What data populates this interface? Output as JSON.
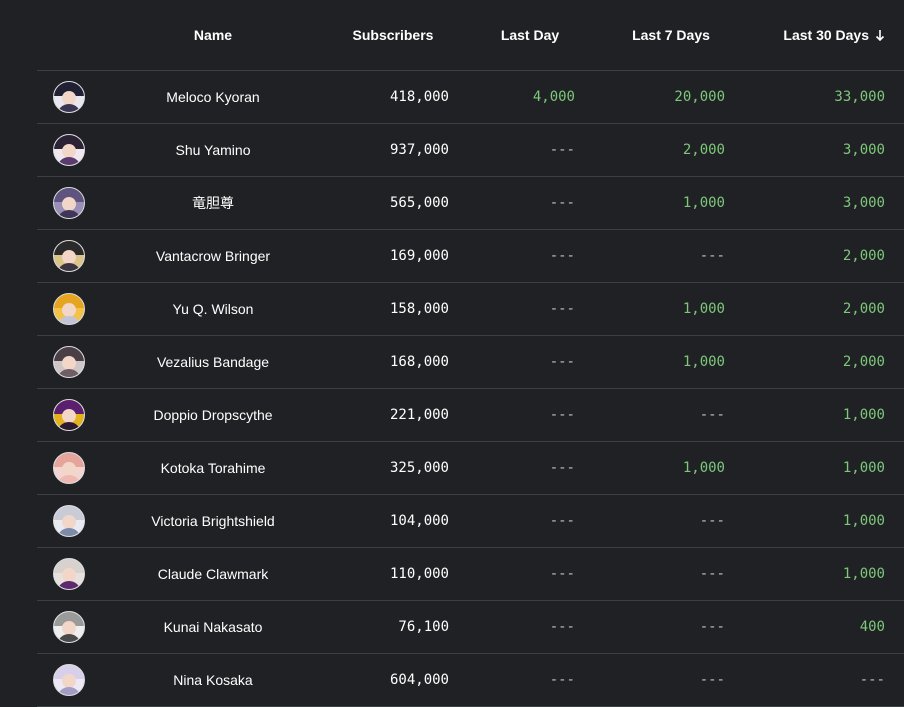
{
  "columns": {
    "name": "Name",
    "subscribers": "Subscribers",
    "last_day": "Last Day",
    "last_7": "Last 7 Days",
    "last_30": "Last 30 Days"
  },
  "sort_icon": "arrow-down-icon",
  "rows": [
    {
      "name": "Meloco Kyoran",
      "subs": "418,000",
      "day": "4,000",
      "week": "20,000",
      "month": "33,000",
      "avatar": {
        "bg": "#e8e6ee",
        "hair": "#1f2033",
        "body": "#3a3550"
      }
    },
    {
      "name": "Shu Yamino",
      "subs": "937,000",
      "day": "---",
      "week": "2,000",
      "month": "3,000",
      "avatar": {
        "bg": "#efe9ef",
        "hair": "#2b2236",
        "body": "#5b3a6e"
      }
    },
    {
      "name": "竜胆尊",
      "subs": "565,000",
      "day": "---",
      "week": "1,000",
      "month": "3,000",
      "avatar": {
        "bg": "#9a8fb6",
        "hair": "#5f547e",
        "body": "#3f3656"
      }
    },
    {
      "name": "Vantacrow Bringer",
      "subs": "169,000",
      "day": "---",
      "week": "---",
      "month": "2,000",
      "avatar": {
        "bg": "#d9c58a",
        "hair": "#2a2a2a",
        "body": "#3a3340"
      }
    },
    {
      "name": "Yu Q. Wilson",
      "subs": "158,000",
      "day": "---",
      "week": "1,000",
      "month": "2,000",
      "avatar": {
        "bg": "#f3c24a",
        "hair": "#e6a520",
        "body": "#c0c4d8"
      }
    },
    {
      "name": "Vezalius Bandage",
      "subs": "168,000",
      "day": "---",
      "week": "1,000",
      "month": "2,000",
      "avatar": {
        "bg": "#cfc7c7",
        "hair": "#4a3f45",
        "body": "#6f5e66"
      }
    },
    {
      "name": "Doppio Dropscythe",
      "subs": "221,000",
      "day": "---",
      "week": "---",
      "month": "1,000",
      "avatar": {
        "bg": "#e3b21d",
        "hair": "#5a1f6e",
        "body": "#2c1a34"
      }
    },
    {
      "name": "Kotoka Torahime",
      "subs": "325,000",
      "day": "---",
      "week": "1,000",
      "month": "1,000",
      "avatar": {
        "bg": "#f1d6cf",
        "hair": "#e6a49a",
        "body": "#f0b8b0"
      }
    },
    {
      "name": "Victoria Brightshield",
      "subs": "104,000",
      "day": "---",
      "week": "---",
      "month": "1,000",
      "avatar": {
        "bg": "#e8eaf0",
        "hair": "#c9ccd6",
        "body": "#7c8aa8"
      }
    },
    {
      "name": "Claude Clawmark",
      "subs": "110,000",
      "day": "---",
      "week": "---",
      "month": "1,000",
      "avatar": {
        "bg": "#e6e1df",
        "hair": "#d8d2cf",
        "body": "#5e2a6e"
      }
    },
    {
      "name": "Kunai Nakasato",
      "subs": "76,100",
      "day": "---",
      "week": "---",
      "month": "400",
      "avatar": {
        "bg": "#eeeeee",
        "hair": "#9a9a9a",
        "body": "#4a4a4a"
      }
    },
    {
      "name": "Nina Kosaka",
      "subs": "604,000",
      "day": "---",
      "week": "---",
      "month": "---",
      "avatar": {
        "bg": "#ece8f4",
        "hair": "#d8d0ea",
        "body": "#a39cc4"
      }
    }
  ],
  "colors": {
    "background": "#202124",
    "positive": "#7dc87b",
    "divider": "#3c4043"
  }
}
